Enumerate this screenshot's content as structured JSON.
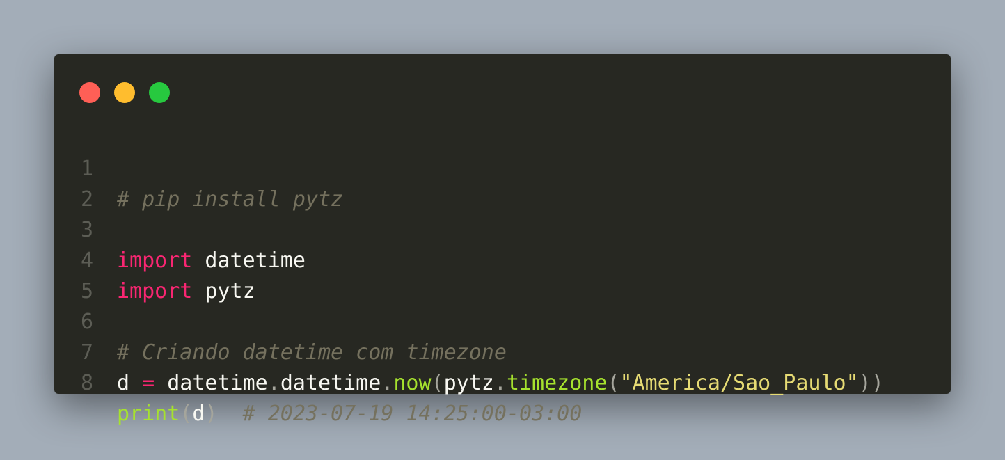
{
  "window": {
    "controls": {
      "close_color": "#ff5f56",
      "minimize_color": "#ffbd2e",
      "maximize_color": "#27c93f"
    }
  },
  "editor": {
    "theme_colors": {
      "background": "#272822",
      "comment": "#75715e",
      "keyword": "#f92672",
      "function": "#a6e22e",
      "string": "#e6db74",
      "text": "#f8f8f2"
    },
    "lines": [
      {
        "number": "1",
        "comment": "# pip install pytz"
      },
      {
        "number": "2"
      },
      {
        "number": "3",
        "keyword": "import",
        "module": " datetime"
      },
      {
        "number": "4",
        "keyword": "import",
        "module": " pytz"
      },
      {
        "number": "5"
      },
      {
        "number": "6",
        "comment": "# Criando datetime com timezone"
      },
      {
        "number": "7",
        "var": "d",
        "op": "=",
        "mod1": "datetime",
        "dot1": ".",
        "cls": "datetime",
        "dot2": ".",
        "method1": "now",
        "paren1": "(",
        "mod2": "pytz",
        "dot3": ".",
        "method2": "timezone",
        "paren2": "(",
        "string": "\"America/Sao_Paulo\"",
        "paren3": "))"
      },
      {
        "number": "8",
        "func": "print",
        "paren_open": "(",
        "arg": "d",
        "paren_close": ")",
        "comment": "# 2023-07-19 14:25:00-03:00"
      }
    ]
  }
}
